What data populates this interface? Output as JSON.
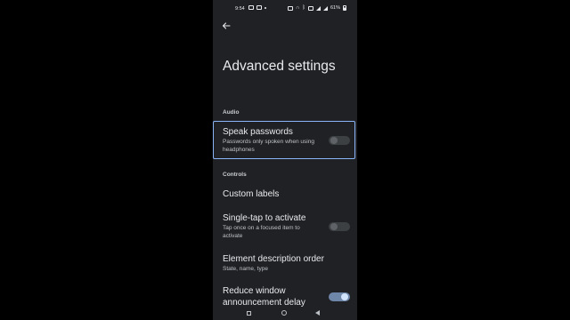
{
  "status_bar": {
    "time": "9:54",
    "battery": "61%",
    "icons": [
      "message-icon",
      "box-icon",
      "dot-icon",
      "wifi-icon",
      "headphones-icon",
      "bluetooth-icon",
      "mute-icon",
      "signal-icon",
      "signal-icon",
      "battery-icon"
    ]
  },
  "header": {
    "back_icon": "back-arrow-icon",
    "title": "Advanced settings"
  },
  "sections": {
    "audio": "Audio",
    "controls": "Controls"
  },
  "items": {
    "speak_passwords": {
      "title": "Speak passwords",
      "subtitle": "Passwords only spoken when using headphones",
      "toggle": "off"
    },
    "custom_labels": {
      "title": "Custom labels"
    },
    "single_tap": {
      "title": "Single-tap to activate",
      "subtitle": "Tap once on a focused item to activate",
      "toggle": "off"
    },
    "element_order": {
      "title": "Element description order",
      "subtitle": "State, name, type"
    },
    "reduce_window": {
      "title": "Reduce window",
      "title_line2": "announcement delay",
      "toggle": "on"
    }
  },
  "colors": {
    "background": "#202124",
    "focus_outline": "#8ab4f8",
    "toggle_on_track": "#6e86a8",
    "toggle_on_thumb": "#d2e3fc"
  },
  "nav_bar": {
    "icons": [
      "recents-icon",
      "home-icon",
      "back-icon"
    ]
  }
}
